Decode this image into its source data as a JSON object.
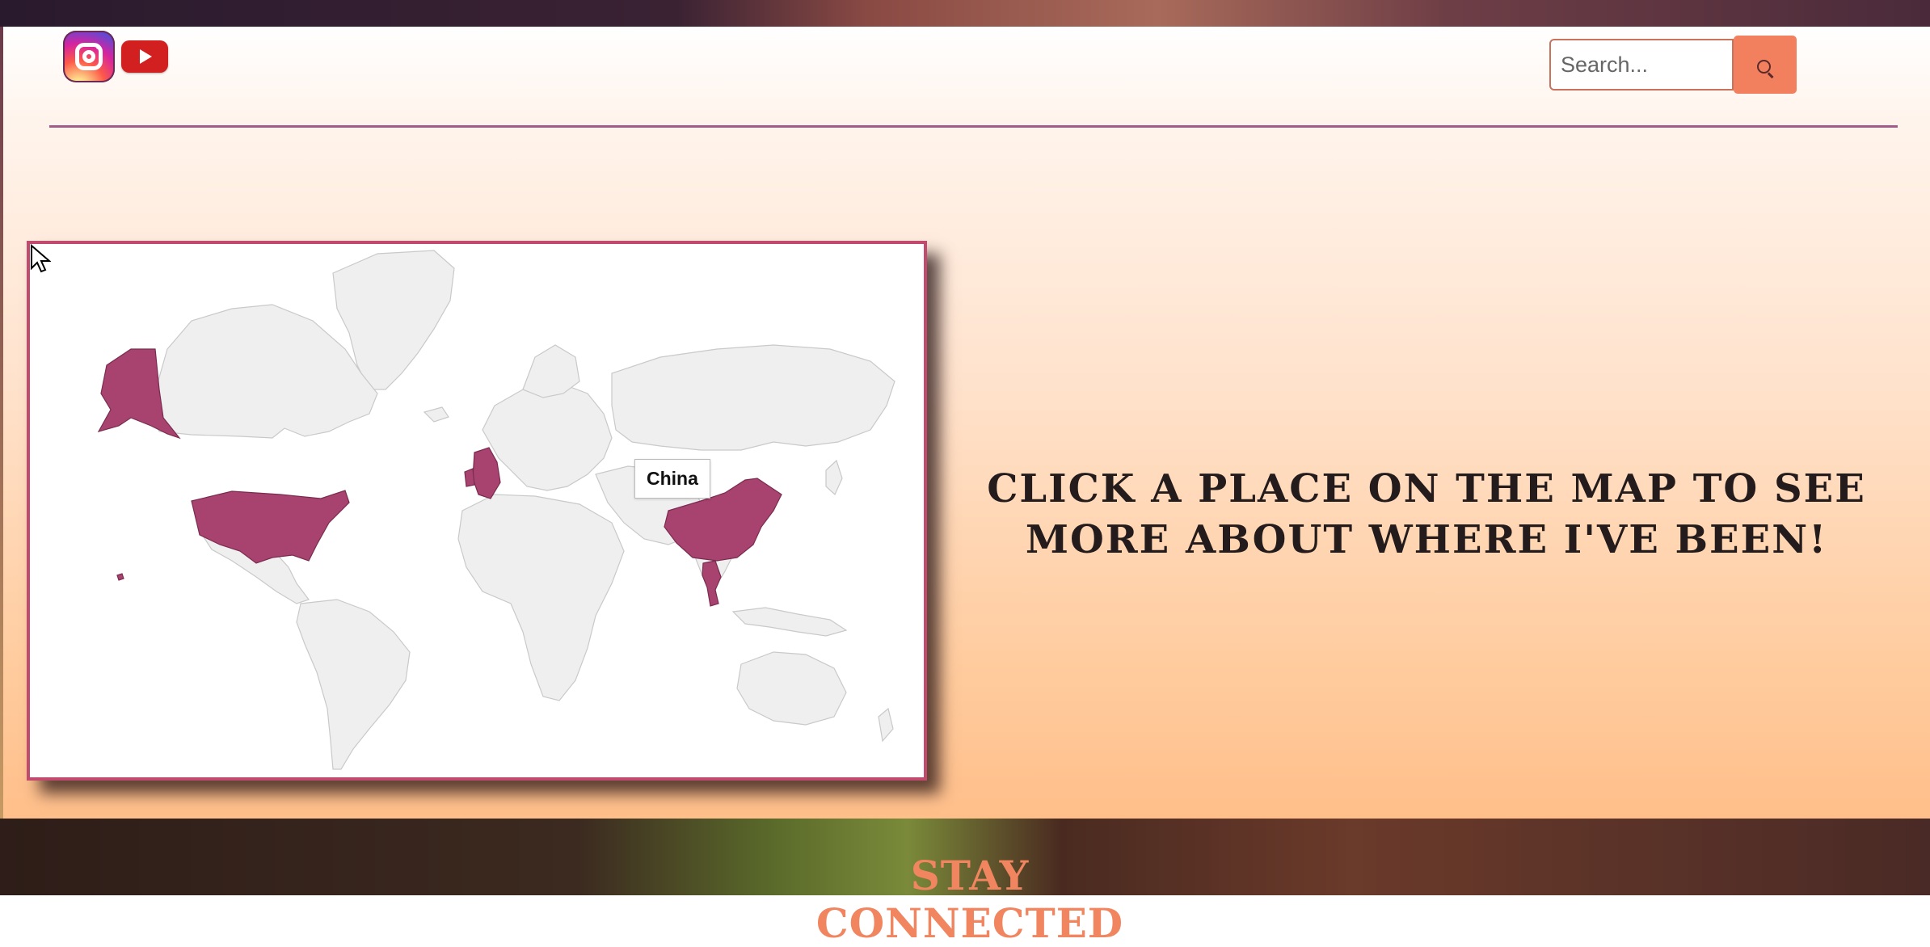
{
  "header": {
    "social": [
      {
        "name": "instagram",
        "icon": "instagram-icon"
      },
      {
        "name": "youtube",
        "icon": "youtube-icon"
      }
    ],
    "search": {
      "placeholder": "Search...",
      "value": ""
    }
  },
  "map": {
    "visited_countries": [
      "United States",
      "Alaska",
      "United Kingdom",
      "China",
      "Thailand"
    ],
    "highlight_color": "#a8426e",
    "land_color": "#efefef",
    "border_color": "#c9c9c9",
    "tooltip": "China"
  },
  "main": {
    "cta_line1": "Click a place on the map to see",
    "cta_line2": "more about where I've been!"
  },
  "footer": {
    "heading": "STAY CONNECTED"
  },
  "colors": {
    "accent": "#f2805f",
    "divider": "#a15a8a",
    "map_border": "#c14a6e",
    "footer_heading": "#f08560"
  }
}
